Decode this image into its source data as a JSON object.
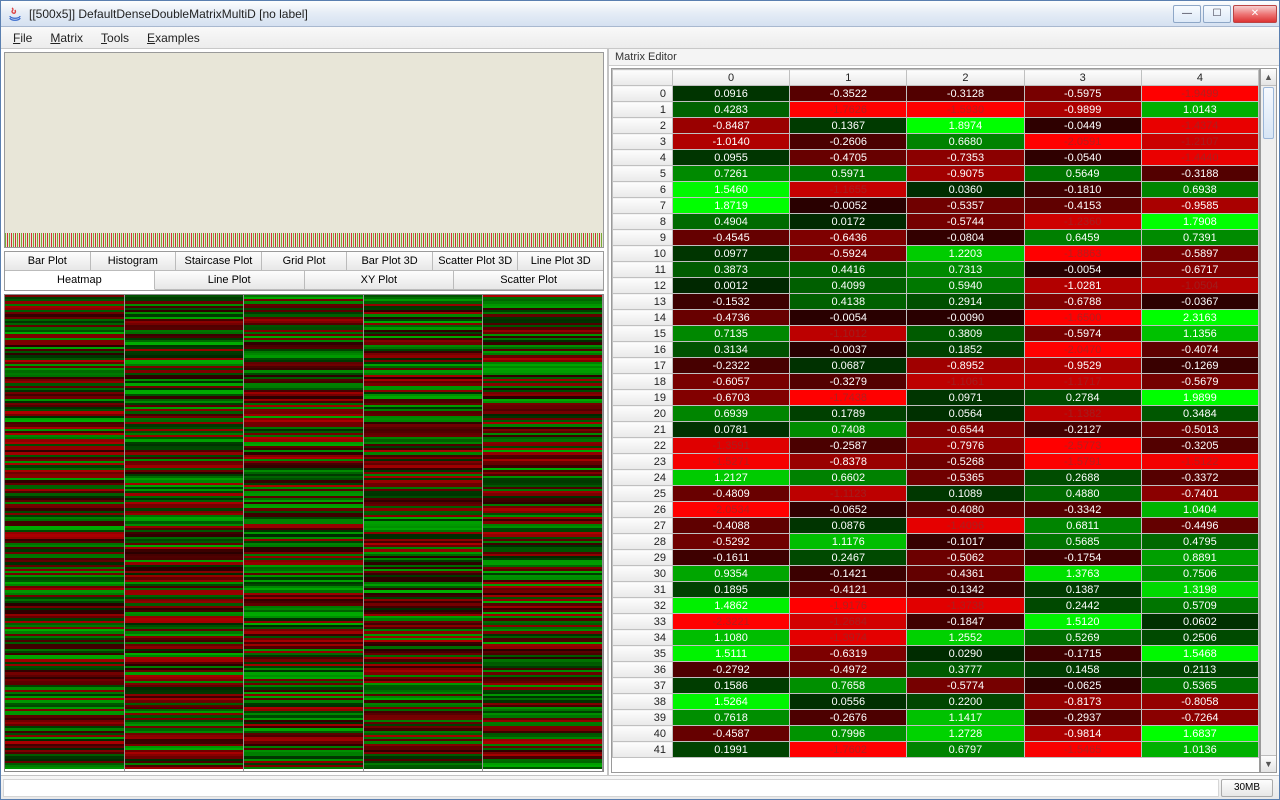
{
  "window": {
    "title": "[[500x5]] DefaultDenseDoubleMatrixMultiD [no label]"
  },
  "menu": {
    "file": "File",
    "matrix": "Matrix",
    "tools": "Tools",
    "examples": "Examples"
  },
  "tabs_row1": [
    {
      "id": "barplot",
      "label": "Bar Plot"
    },
    {
      "id": "histogram",
      "label": "Histogram"
    },
    {
      "id": "staircase",
      "label": "Staircase Plot"
    },
    {
      "id": "gridplot",
      "label": "Grid Plot"
    },
    {
      "id": "barplot3d",
      "label": "Bar Plot 3D"
    },
    {
      "id": "scatter3d",
      "label": "Scatter Plot 3D"
    },
    {
      "id": "lineplot3d",
      "label": "Line Plot 3D"
    }
  ],
  "tabs_row2": [
    {
      "id": "heatmap",
      "label": "Heatmap",
      "selected": true
    },
    {
      "id": "lineplot",
      "label": "Line Plot"
    },
    {
      "id": "xyplot",
      "label": "XY Plot"
    },
    {
      "id": "scatter",
      "label": "Scatter Plot"
    }
  ],
  "editor": {
    "label": "Matrix Editor",
    "columns": [
      "0",
      "1",
      "2",
      "3",
      "4"
    ],
    "rows": [
      {
        "i": "0",
        "v": [
          "0.0916",
          "-0.3522",
          "-0.3128",
          "-0.5975",
          "-1.9499"
        ]
      },
      {
        "i": "1",
        "v": [
          "0.4283",
          "-1.7626",
          "-1.5930",
          "-0.9899",
          "1.0143"
        ]
      },
      {
        "i": "2",
        "v": [
          "-0.8487",
          "0.1367",
          "1.8974",
          "-0.0449",
          "-1.4374"
        ]
      },
      {
        "i": "3",
        "v": [
          "-1.0140",
          "-0.2606",
          "0.6680",
          "-2.0591",
          "-1.2107"
        ]
      },
      {
        "i": "4",
        "v": [
          "0.0955",
          "-0.4705",
          "-0.7353",
          "-0.0540",
          "-1.4440"
        ]
      },
      {
        "i": "5",
        "v": [
          "0.7261",
          "0.5971",
          "-0.9075",
          "0.5649",
          "-0.3188"
        ]
      },
      {
        "i": "6",
        "v": [
          "1.5460",
          "-1.1655",
          "0.0360",
          "-0.1810",
          "0.6938"
        ]
      },
      {
        "i": "7",
        "v": [
          "1.8719",
          "-0.0052",
          "-0.5357",
          "-0.4153",
          "-0.9585"
        ]
      },
      {
        "i": "8",
        "v": [
          "0.4904",
          "0.0172",
          "-0.5744",
          "-1.2360",
          "1.7908"
        ]
      },
      {
        "i": "9",
        "v": [
          "-0.4545",
          "-0.6436",
          "-0.0804",
          "0.6459",
          "0.7391"
        ]
      },
      {
        "i": "10",
        "v": [
          "0.0977",
          "-0.5924",
          "1.2203",
          "-1.8863",
          "-0.5897"
        ]
      },
      {
        "i": "11",
        "v": [
          "0.3873",
          "0.4416",
          "0.7313",
          "-0.0054",
          "-0.6717"
        ]
      },
      {
        "i": "12",
        "v": [
          "0.0012",
          "0.4099",
          "0.5940",
          "-1.0281",
          "-1.0504"
        ]
      },
      {
        "i": "13",
        "v": [
          "-0.1532",
          "0.4138",
          "0.2914",
          "-0.6788",
          "-0.0367"
        ]
      },
      {
        "i": "14",
        "v": [
          "-0.4736",
          "-0.0054",
          "-0.0090",
          "-1.6500",
          "2.3163"
        ]
      },
      {
        "i": "15",
        "v": [
          "0.7135",
          "-1.1012",
          "0.3809",
          "-0.5974",
          "1.1356"
        ]
      },
      {
        "i": "16",
        "v": [
          "0.3134",
          "-0.0037",
          "0.1852",
          "-2.0470",
          "-0.4074"
        ]
      },
      {
        "i": "17",
        "v": [
          "-0.2322",
          "0.0687",
          "-0.8952",
          "-0.9529",
          "-0.1269"
        ]
      },
      {
        "i": "18",
        "v": [
          "-0.6057",
          "-0.3279",
          "-1.1061",
          "-1.1717",
          "-0.5679"
        ]
      },
      {
        "i": "19",
        "v": [
          "-0.6703",
          "-1.7438",
          "0.0971",
          "0.2784",
          "1.9899"
        ]
      },
      {
        "i": "20",
        "v": [
          "0.6939",
          "0.1789",
          "0.0564",
          "-1.1382",
          "0.3484"
        ]
      },
      {
        "i": "21",
        "v": [
          "0.0781",
          "0.7408",
          "-0.6544",
          "-0.2127",
          "-0.5013"
        ]
      },
      {
        "i": "22",
        "v": [
          "-1.3591",
          "-0.2587",
          "-0.7976",
          "-2.5773",
          "-0.3205"
        ]
      },
      {
        "i": "23",
        "v": [
          "-1.5271",
          "-0.8378",
          "-0.5268",
          "-1.5791",
          "-1.5122"
        ]
      },
      {
        "i": "24",
        "v": [
          "1.2127",
          "0.6602",
          "-0.5365",
          "0.2688",
          "-0.3372"
        ]
      },
      {
        "i": "25",
        "v": [
          "-0.4809",
          "-1.1123",
          "0.1089",
          "0.4880",
          "-0.7401"
        ]
      },
      {
        "i": "26",
        "v": [
          "-2.0534",
          "-0.0652",
          "-0.4080",
          "-0.3342",
          "1.0404"
        ]
      },
      {
        "i": "27",
        "v": [
          "-0.4088",
          "0.0876",
          "-1.4096",
          "0.6811",
          "-0.4496"
        ]
      },
      {
        "i": "28",
        "v": [
          "-0.5292",
          "1.1176",
          "-0.1017",
          "0.5685",
          "0.4795"
        ]
      },
      {
        "i": "29",
        "v": [
          "-0.1611",
          "0.2467",
          "-0.5062",
          "-0.1754",
          "0.8891"
        ]
      },
      {
        "i": "30",
        "v": [
          "0.9354",
          "-0.1421",
          "-0.4361",
          "1.3763",
          "0.7506"
        ]
      },
      {
        "i": "31",
        "v": [
          "0.1895",
          "-0.4121",
          "-0.1342",
          "0.1387",
          "1.3198"
        ]
      },
      {
        "i": "32",
        "v": [
          "1.4862",
          "-1.9176",
          "-1.3738",
          "0.2442",
          "0.5709"
        ]
      },
      {
        "i": "33",
        "v": [
          "-2.3221",
          "-1.2684",
          "-0.1847",
          "1.5120",
          "0.0602"
        ]
      },
      {
        "i": "34",
        "v": [
          "1.1080",
          "-1.3974",
          "1.2552",
          "0.5269",
          "0.2506"
        ]
      },
      {
        "i": "35",
        "v": [
          "1.5111",
          "-0.6319",
          "0.0290",
          "-0.1715",
          "1.5468"
        ]
      },
      {
        "i": "36",
        "v": [
          "-0.2792",
          "-0.4972",
          "0.3777",
          "0.1458",
          "0.2113"
        ]
      },
      {
        "i": "37",
        "v": [
          "0.1586",
          "0.7658",
          "-0.5774",
          "-0.0625",
          "0.5365"
        ]
      },
      {
        "i": "38",
        "v": [
          "1.5264",
          "0.0556",
          "0.2200",
          "-0.8173",
          "-0.8058"
        ]
      },
      {
        "i": "39",
        "v": [
          "0.7618",
          "-0.2676",
          "1.1417",
          "-0.2937",
          "-0.7264"
        ]
      },
      {
        "i": "40",
        "v": [
          "-0.4587",
          "0.7996",
          "1.2728",
          "-0.9814",
          "1.6837"
        ]
      },
      {
        "i": "41",
        "v": [
          "0.1991",
          "-1.7602",
          "0.6797",
          "-1.5465",
          "1.0136"
        ]
      }
    ]
  },
  "status": {
    "memory": "30MB"
  },
  "chart_data": {
    "type": "heatmap",
    "title": "",
    "xlabel": "",
    "ylabel": "",
    "x_categories": [
      "0",
      "1",
      "2",
      "3",
      "4"
    ],
    "y_range": [
      0,
      499
    ],
    "colormap": "red-black-green (negative→red, zero→black, positive→green)",
    "note": "Heatmap of full 500×5 matrix; visible subset of values given under editor.rows"
  }
}
